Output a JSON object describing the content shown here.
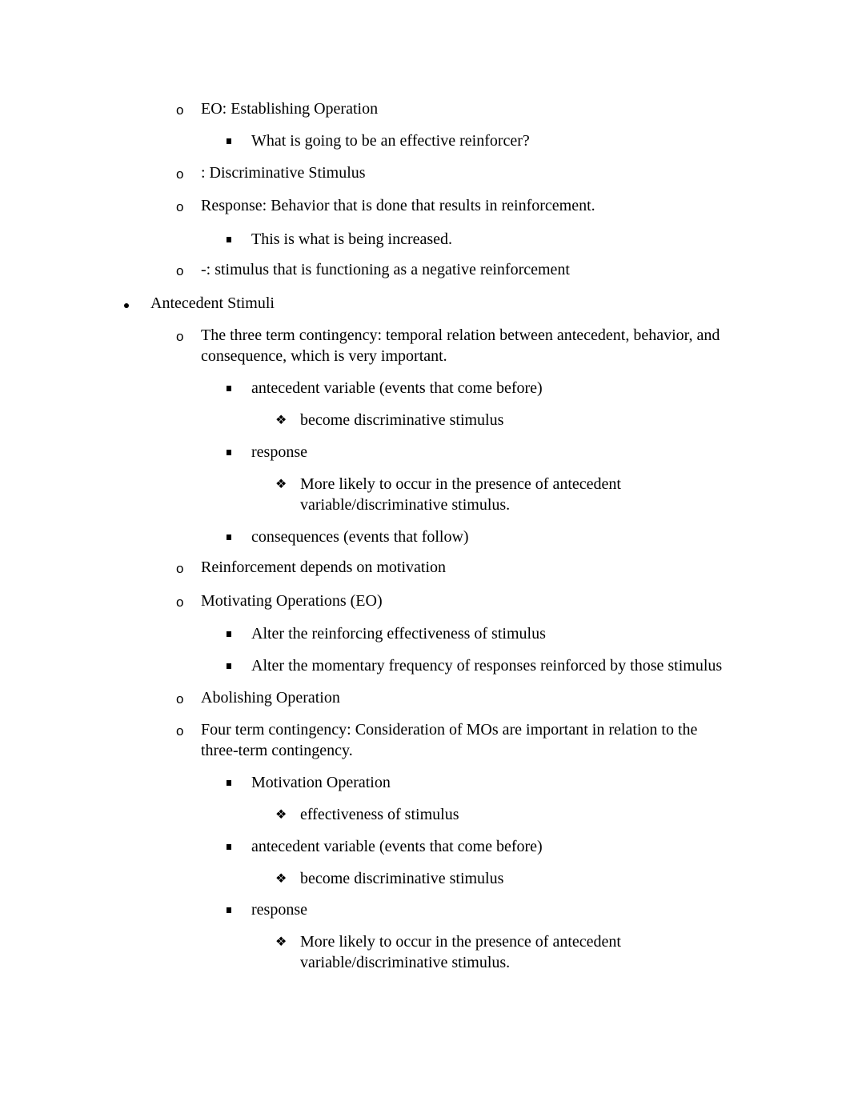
{
  "document": {
    "items": [
      {
        "level": 2,
        "bullet": "o",
        "text": "EO: Establishing Operation"
      },
      {
        "level": 3,
        "bullet": "square",
        "text": "What is going to be an effective reinforcer?"
      },
      {
        "level": 2,
        "bullet": "o",
        "text": ": Discriminative Stimulus"
      },
      {
        "level": 2,
        "bullet": "o",
        "text": "Response: Behavior that is done that results in reinforcement."
      },
      {
        "level": 3,
        "bullet": "square",
        "text": "This is what is being increased."
      },
      {
        "level": 2,
        "bullet": "o",
        "text": "-: stimulus that is functioning as a negative reinforcement"
      },
      {
        "level": 1,
        "bullet": "dot",
        "text": "Antecedent Stimuli"
      },
      {
        "level": 2,
        "bullet": "o",
        "lines": [
          "The three term contingency: temporal relation between antecedent, behavior, and",
          "consequence, which is very important."
        ]
      },
      {
        "level": 3,
        "bullet": "square",
        "text": "antecedent variable (events that come before)"
      },
      {
        "level": 4,
        "bullet": "diamond",
        "text": "become discriminative stimulus"
      },
      {
        "level": 3,
        "bullet": "square",
        "text": "response"
      },
      {
        "level": 4,
        "bullet": "diamond",
        "lines": [
          "More likely to occur in the presence of antecedent",
          "variable/discriminative stimulus."
        ]
      },
      {
        "level": 3,
        "bullet": "square",
        "text": "consequences (events that follow)"
      },
      {
        "level": 2,
        "bullet": "o",
        "text": "Reinforcement depends on motivation"
      },
      {
        "level": 2,
        "bullet": "o",
        "text": "Motivating Operations (EO)"
      },
      {
        "level": 3,
        "bullet": "square",
        "text": "Alter the reinforcing effectiveness of stimulus"
      },
      {
        "level": 3,
        "bullet": "square",
        "text": "Alter the momentary frequency of responses reinforced by those stimulus"
      },
      {
        "level": 2,
        "bullet": "o",
        "text": "Abolishing Operation"
      },
      {
        "level": 2,
        "bullet": "o",
        "lines": [
          "Four term contingency: Consideration of MOs are important in relation to the",
          "three-term contingency."
        ]
      },
      {
        "level": 3,
        "bullet": "square",
        "text": "Motivation Operation"
      },
      {
        "level": 4,
        "bullet": "diamond",
        "text": "effectiveness of stimulus"
      },
      {
        "level": 3,
        "bullet": "square",
        "text": "antecedent variable (events that come before)"
      },
      {
        "level": 4,
        "bullet": "diamond",
        "text": "become discriminative stimulus"
      },
      {
        "level": 3,
        "bullet": "square",
        "text": "response"
      },
      {
        "level": 4,
        "bullet": "diamond",
        "lines": [
          "More likely to occur in the presence of antecedent",
          "variable/discriminative stimulus."
        ]
      }
    ]
  }
}
